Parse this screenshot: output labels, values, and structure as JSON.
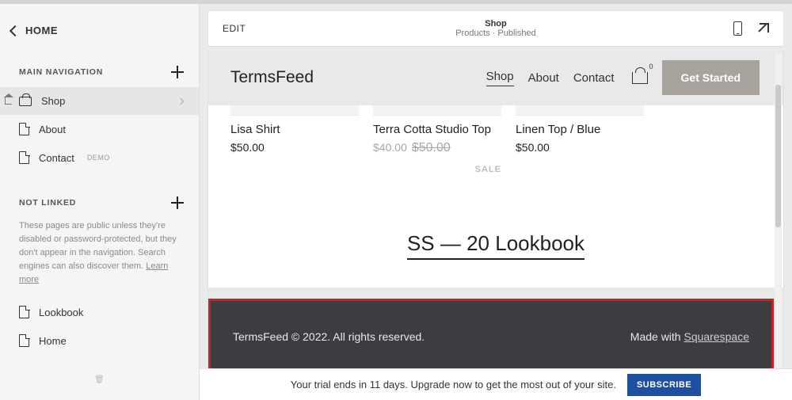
{
  "sidebar": {
    "home_label": "HOME",
    "main_nav_label": "MAIN NAVIGATION",
    "not_linked_label": "NOT LINKED",
    "not_linked_desc_1": "These pages are public unless they're disabled or password-protected, but they don't appear in the navigation. Search engines can also discover them. ",
    "not_linked_learn": "Learn more",
    "main_items": [
      {
        "label": "Shop",
        "icon": "cart",
        "active": true
      },
      {
        "label": "About",
        "icon": "page"
      },
      {
        "label": "Contact",
        "icon": "page",
        "tag": "DEMO"
      }
    ],
    "not_linked_items": [
      {
        "label": "Lookbook",
        "icon": "page"
      },
      {
        "label": "Home",
        "icon": "page"
      }
    ]
  },
  "editbar": {
    "edit": "EDIT",
    "title": "Shop",
    "subtitle": "Products · Published"
  },
  "site": {
    "brand": "TermsFeed",
    "nav": {
      "shop": "Shop",
      "about": "About",
      "contact": "Contact",
      "cart_count": "0"
    },
    "get_started": "Get Started",
    "products": [
      {
        "name": "Lisa Shirt",
        "price": "$50.00"
      },
      {
        "name": "Terra Cotta Studio Top",
        "price": "$40.00",
        "old_price": "$50.00",
        "sale": "SALE"
      },
      {
        "name": "Linen Top / Blue",
        "price": "$50.00"
      }
    ],
    "lookbook": "SS — 20 Lookbook",
    "footer_left": "TermsFeed © 2022. All rights reserved.",
    "footer_right_prefix": "Made with ",
    "footer_right_link": "Squarespace"
  },
  "trial": {
    "text": "Your trial ends in 11 days. Upgrade now to get the most out of your site.",
    "button": "SUBSCRIBE"
  }
}
